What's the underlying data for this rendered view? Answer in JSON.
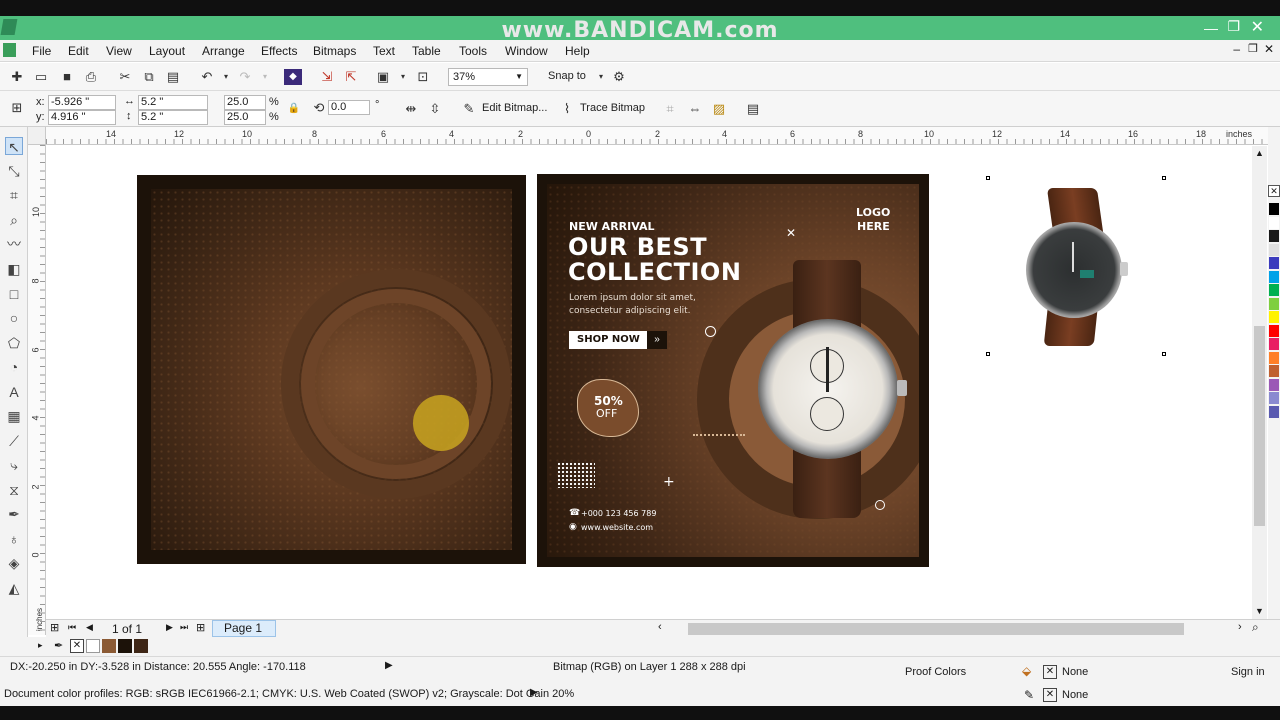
{
  "watermark": "www.BANDICAM.com",
  "menu": [
    "File",
    "Edit",
    "View",
    "Layout",
    "Arrange",
    "Effects",
    "Bitmaps",
    "Text",
    "Table",
    "Tools",
    "Window",
    "Help"
  ],
  "standard_toolbar": {
    "zoom": "37%",
    "snap_label": "Snap to"
  },
  "property_bar": {
    "x_label": "x:",
    "x_value": "-5.926 \"",
    "y_label": "y:",
    "y_value": "4.916 \"",
    "w_value": "5.2 \"",
    "h_value": "5.2 \"",
    "scale_w": "25.0",
    "scale_h": "25.0",
    "pct": "%",
    "rotation": "0.0",
    "deg": "°",
    "edit_bitmap": "Edit Bitmap...",
    "trace_bitmap": "Trace Bitmap"
  },
  "ruler": {
    "h_ticks": [
      "14",
      "12",
      "10",
      "8",
      "6",
      "4",
      "2",
      "0",
      "2",
      "4",
      "6",
      "8",
      "10",
      "12",
      "14",
      "16",
      "18"
    ],
    "unit": "inches",
    "v_ticks": [
      "10",
      "8",
      "6",
      "4",
      "2",
      "0"
    ]
  },
  "ad": {
    "new_arrival": "NEW ARRIVAL",
    "line1": "OUR BEST",
    "line2": "COLLECTION",
    "lorem1": "Lorem ipsum dolor sit amet,",
    "lorem2": "consectetur adipiscing elit.",
    "shop_now": "SHOP NOW",
    "logo1": "LOGO",
    "logo2": "HERE",
    "discount1": "50%",
    "discount2": "OFF",
    "phone": "+000 123 456 789",
    "website": "www.website.com"
  },
  "pagebar": {
    "page_count": "1 of 1",
    "page_tab": "Page 1"
  },
  "status": {
    "cursor_info": "DX:-20.250 in DY:-3.528 in Distance: 20.555 Angle: -170.118",
    "object_info": "Bitmap (RGB) on Layer 1 288 x 288 dpi",
    "proof_colors": "Proof Colors",
    "fill_none": "None",
    "outline_none": "None",
    "sign_in": "Sign in",
    "color_profiles": "Document color profiles: RGB: sRGB IEC61966-2.1; CMYK: U.S. Web Coated (SWOP) v2; Grayscale: Dot Gain 20%"
  },
  "colors": {
    "ad_brown_dark": "#2a1a0e",
    "ad_brown_mid": "#6b4328",
    "accent_yellow": "#c9a520",
    "palette": [
      "#000000",
      "#ffffff",
      "#1a1a1a",
      "#e0e0e0",
      "#3b3bbd",
      "#00a2e8",
      "#00b050",
      "#7fcf3f",
      "#fff200",
      "#ff0000",
      "#e91e63",
      "#ff7f27",
      "#c06030",
      "#9b59b6",
      "#8a8ad0",
      "#5a5ab0"
    ]
  }
}
